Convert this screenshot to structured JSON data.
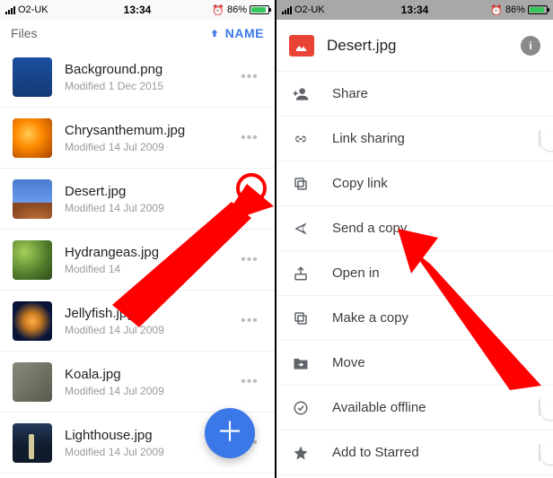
{
  "status": {
    "carrier": "O2-UK",
    "time": "13:34",
    "battery_pct": "86%"
  },
  "left": {
    "header_label": "Files",
    "sort_label": "NAME",
    "files": [
      {
        "name": "Background.png",
        "modified": "Modified 1 Dec 2015"
      },
      {
        "name": "Chrysanthemum.jpg",
        "modified": "Modified 14 Jul 2009"
      },
      {
        "name": "Desert.jpg",
        "modified": "Modified 14 Jul 2009"
      },
      {
        "name": "Hydrangeas.jpg",
        "modified": "Modified 14"
      },
      {
        "name": "Jellyfish.jpg",
        "modified": "Modified 14 Jul 2009"
      },
      {
        "name": "Koala.jpg",
        "modified": "Modified 14 Jul 2009"
      },
      {
        "name": "Lighthouse.jpg",
        "modified": "Modified 14 Jul 2009"
      }
    ]
  },
  "right": {
    "title": "Desert.jpg",
    "actions": {
      "share": "Share",
      "link_sharing": "Link sharing",
      "copy_link": "Copy link",
      "send_copy": "Send a copy",
      "open_in": "Open in",
      "make_copy": "Make a copy",
      "move": "Move",
      "available_offline": "Available offline",
      "add_starred": "Add to Starred"
    }
  }
}
